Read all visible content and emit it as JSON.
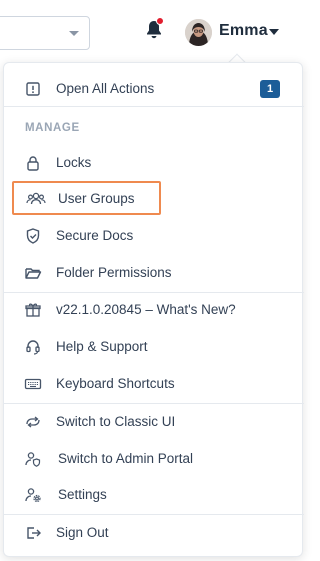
{
  "header": {
    "user_name": "Emma",
    "notification_dot_color": "#e11d2e"
  },
  "menu": {
    "open_all_actions": {
      "label": "Open All Actions",
      "badge": "1",
      "icon": "exclamation-box-icon"
    },
    "section_manage": "MANAGE",
    "manage_items": [
      {
        "label": "Locks",
        "icon": "lock-icon"
      },
      {
        "label": "User Groups",
        "icon": "user-group-icon"
      },
      {
        "label": "Secure Docs",
        "icon": "shield-check-icon"
      },
      {
        "label": "Folder Permissions",
        "icon": "folder-open-icon"
      }
    ],
    "info_items": [
      {
        "label": "v22.1.0.20845 – What's New?",
        "icon": "gift-icon"
      },
      {
        "label": "Help & Support",
        "icon": "headset-icon"
      },
      {
        "label": "Keyboard Shortcuts",
        "icon": "keyboard-icon"
      }
    ],
    "switch_items": [
      {
        "label": "Switch to Classic UI",
        "icon": "switch-classic-icon"
      },
      {
        "label": "Switch to Admin Portal",
        "icon": "admin-shield-icon"
      },
      {
        "label": "Settings",
        "icon": "user-settings-icon"
      }
    ],
    "sign_out": {
      "label": "Sign Out",
      "icon": "sign-out-icon"
    }
  },
  "colors": {
    "accent_badge": "#1c5d98",
    "highlight_border": "#ef8a4f",
    "text": "#334155",
    "section_title": "#9aa6b5"
  }
}
